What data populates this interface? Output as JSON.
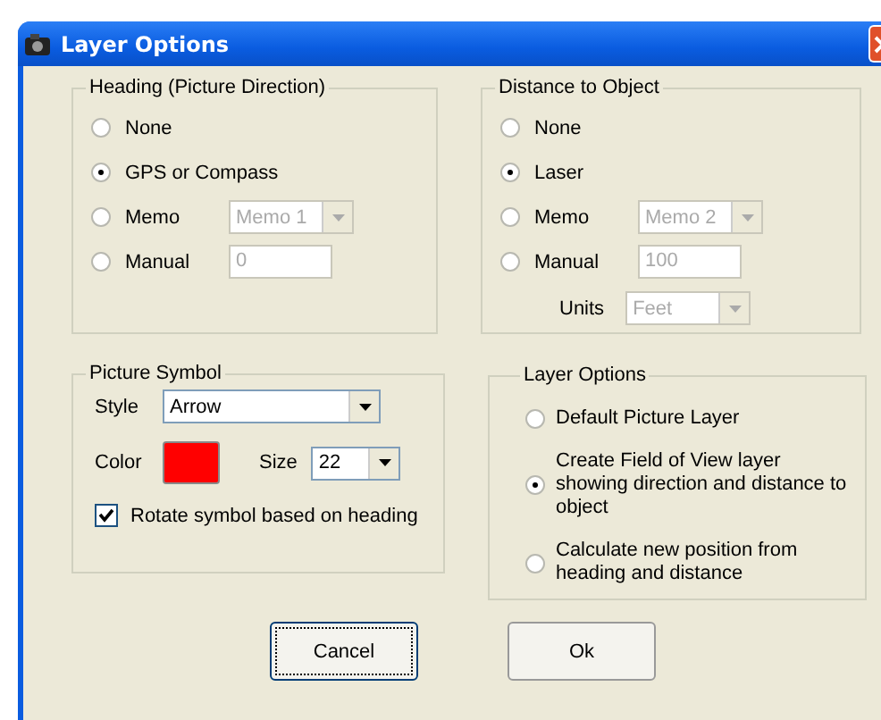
{
  "window": {
    "title": "Layer Options"
  },
  "heading_group": {
    "title": "Heading (Picture Direction)",
    "options": [
      {
        "label": "None",
        "selected": false,
        "kind": "plain"
      },
      {
        "label": "GPS or Compass",
        "selected": true,
        "kind": "plain"
      },
      {
        "label": "Memo",
        "selected": false,
        "kind": "dropdown",
        "value": "Memo 1",
        "disabled": true
      },
      {
        "label": "Manual",
        "selected": false,
        "kind": "text",
        "value": "0",
        "disabled": true
      }
    ]
  },
  "distance_group": {
    "title": "Distance to Object",
    "options": [
      {
        "label": "None",
        "selected": false,
        "kind": "plain"
      },
      {
        "label": "Laser",
        "selected": true,
        "kind": "plain"
      },
      {
        "label": "Memo",
        "selected": false,
        "kind": "dropdown",
        "value": "Memo 2",
        "disabled": true
      },
      {
        "label": "Manual",
        "selected": false,
        "kind": "text",
        "value": "100",
        "disabled": true
      }
    ],
    "units": {
      "label": "Units",
      "value": "Feet",
      "disabled": true
    }
  },
  "symbol_group": {
    "title": "Picture Symbol",
    "style": {
      "label": "Style",
      "value": "Arrow"
    },
    "color": {
      "label": "Color",
      "color": "#ff0000"
    },
    "size": {
      "label": "Size",
      "value": "22"
    },
    "rotate": {
      "label": "Rotate symbol based on heading",
      "checked": true
    }
  },
  "layer_group": {
    "title": "Layer Options",
    "options": [
      {
        "label": "Default Picture Layer",
        "selected": false
      },
      {
        "label": "Create Field of View layer showing direction and distance to object",
        "selected": true
      },
      {
        "label": "Calculate new position from heading and distance",
        "selected": false
      }
    ]
  },
  "buttons": [
    {
      "label": "Cancel",
      "focused": true
    },
    {
      "label": "Ok",
      "focused": false
    }
  ]
}
